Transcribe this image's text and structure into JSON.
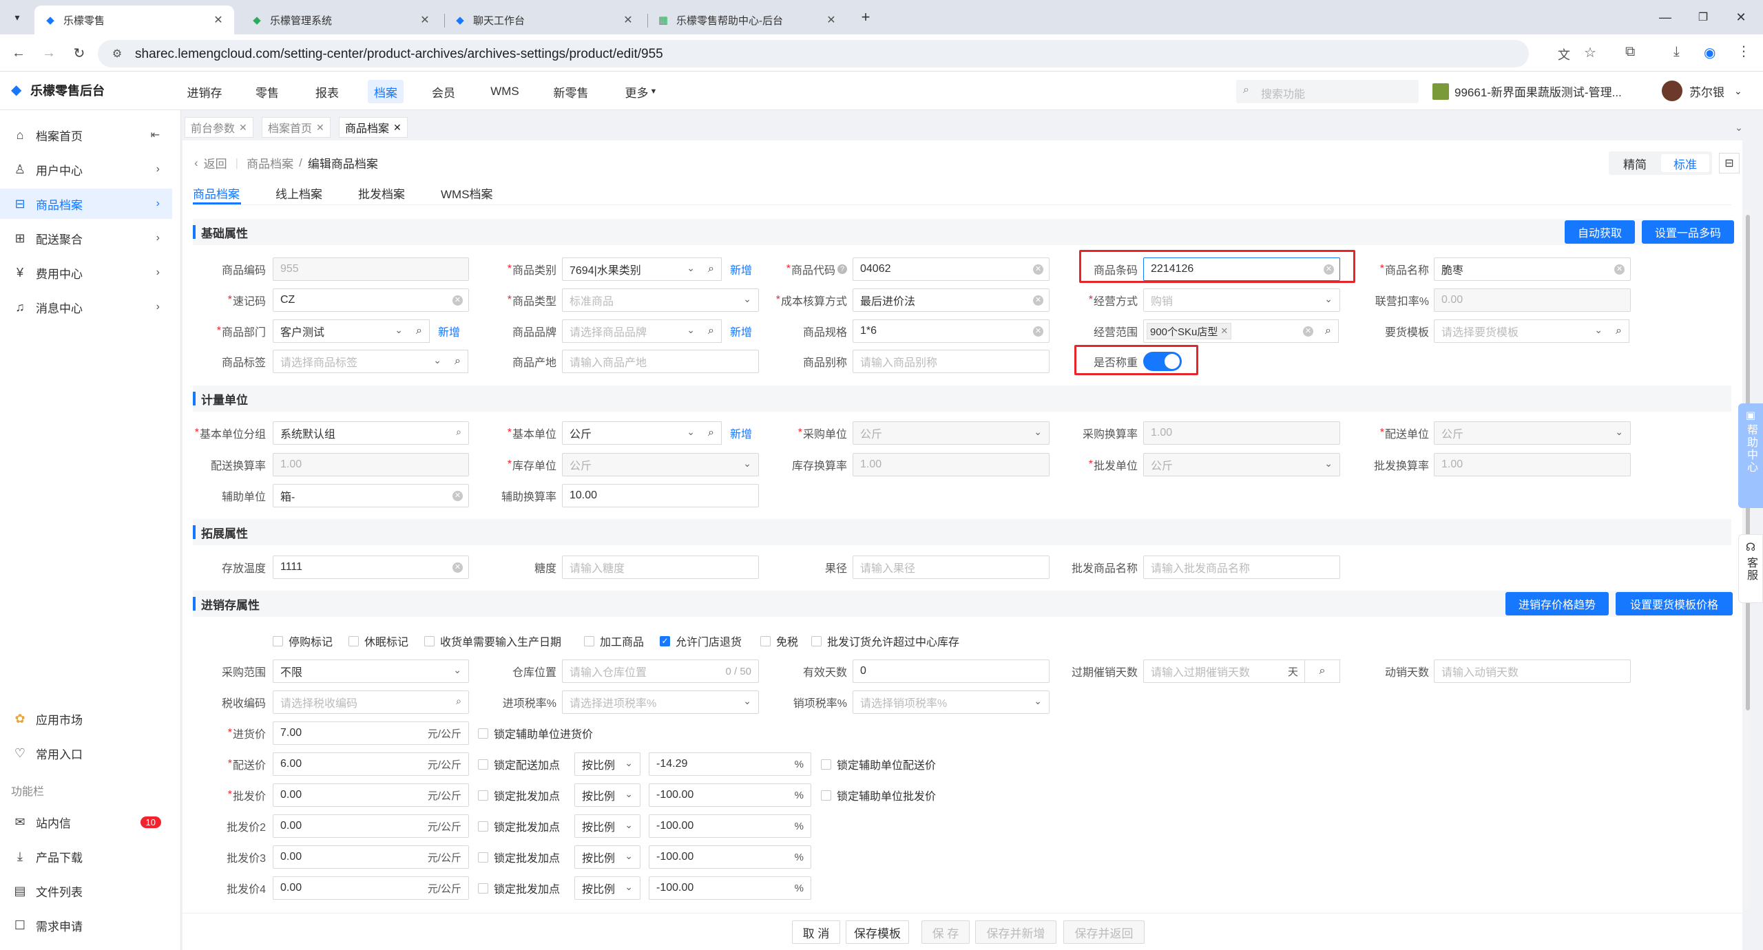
{
  "browser": {
    "tabs": [
      {
        "title": "乐檬零售"
      },
      {
        "title": "乐檬管理系统"
      },
      {
        "title": "聊天工作台"
      },
      {
        "title": "乐檬零售帮助中心-后台"
      }
    ],
    "url": "sharec.lemengcloud.com/setting-center/product-archives/archives-settings/product/edit/955"
  },
  "app": {
    "logo": "乐檬零售后台",
    "nav": [
      "进销存",
      "零售",
      "报表",
      "档案",
      "会员",
      "WMS",
      "新零售",
      "更多"
    ],
    "search_placeholder": "搜索功能",
    "store": "99661-新界面果蔬版测试-管理...",
    "user": "苏尔银"
  },
  "sidebar": {
    "items": [
      {
        "label": "档案首页",
        "icon": "home-icon"
      },
      {
        "label": "用户中心",
        "icon": "user-icon"
      },
      {
        "label": "商品档案",
        "icon": "archive-icon"
      },
      {
        "label": "配送聚合",
        "icon": "delivery-icon"
      },
      {
        "label": "费用中心",
        "icon": "yen-icon"
      },
      {
        "label": "消息中心",
        "icon": "bell-icon"
      }
    ],
    "bottom": [
      {
        "label": "应用市场"
      },
      {
        "label": "常用入口"
      }
    ],
    "section_label": "功能栏",
    "func": [
      {
        "label": "站内信",
        "badge": "10"
      },
      {
        "label": "产品下载"
      },
      {
        "label": "文件列表"
      },
      {
        "label": "需求申请"
      }
    ]
  },
  "page_tabs": [
    "前台参数",
    "档案首页",
    "商品档案"
  ],
  "breadcrumb": {
    "back": "返回",
    "parent": "商品档案",
    "current": "编辑商品档案"
  },
  "mode": {
    "simple": "精简",
    "standard": "标准"
  },
  "sub_tabs": [
    "商品档案",
    "线上档案",
    "批发档案",
    "WMS档案"
  ],
  "basic": {
    "title": "基础属性",
    "btn_auto": "自动获取",
    "btn_multi": "设置一品多码",
    "code_label": "商品编码",
    "code_value": "955",
    "category_label": "商品类别",
    "category_value": "7694|水果类别",
    "add": "新增",
    "pcode_label": "商品代码",
    "pcode_value": "04062",
    "barcode_label": "商品条码",
    "barcode_value": "2214126",
    "name_label": "商品名称",
    "name_value": "脆枣",
    "mnemonic_label": "速记码",
    "mnemonic_value": "CZ",
    "type_label": "商品类型",
    "type_value": "标准商品",
    "cost_label": "成本核算方式",
    "cost_value": "最后进价法",
    "biz_label": "经营方式",
    "biz_value": "购销",
    "rate_label": "联营扣率%",
    "rate_value": "0.00",
    "dept_label": "商品部门",
    "dept_value": "客户测试",
    "brand_label": "商品品牌",
    "brand_placeholder": "请选择商品品牌",
    "spec_label": "商品规格",
    "spec_value": "1*6",
    "scope_label": "经营范围",
    "scope_tag": "900个SKu店型",
    "tpl_label": "要货模板",
    "tpl_placeholder": "请选择要货模板",
    "tag_label": "商品标签",
    "tag_placeholder": "请选择商品标签",
    "origin_label": "商品产地",
    "origin_placeholder": "请输入商品产地",
    "alias_label": "商品别称",
    "alias_placeholder": "请输入商品别称",
    "weigh_label": "是否称重"
  },
  "units": {
    "title": "计量单位",
    "group_label": "基本单位分组",
    "group_value": "系统默认组",
    "base_label": "基本单位",
    "base_value": "公斤",
    "purchase_label": "采购单位",
    "purchase_value": "公斤",
    "pconv_label": "采购换算率",
    "pconv_value": "1.00",
    "dist_label": "配送单位",
    "dist_value": "公斤",
    "dconv_label": "配送换算率",
    "dconv_value": "1.00",
    "stock_label": "库存单位",
    "stock_value": "公斤",
    "sconv_label": "库存换算率",
    "sconv_value": "1.00",
    "whole_label": "批发单位",
    "whole_value": "公斤",
    "wconv_label": "批发换算率",
    "wconv_value": "1.00",
    "aux_label": "辅助单位",
    "aux_value": "箱-",
    "aconv_label": "辅助换算率",
    "aconv_value": "10.00"
  },
  "ext": {
    "title": "拓展属性",
    "temp_label": "存放温度",
    "temp_value": "1111",
    "sugar_label": "糖度",
    "sugar_placeholder": "请输入糖度",
    "dia_label": "果径",
    "dia_placeholder": "请输入果径",
    "wname_label": "批发商品名称",
    "wname_placeholder": "请输入批发商品名称"
  },
  "inv": {
    "title": "进销存属性",
    "btn_trend": "进销存价格趋势",
    "btn_tplprice": "设置要货模板价格",
    "checks": [
      {
        "label": "停购标记",
        "on": false
      },
      {
        "label": "休眠标记",
        "on": false
      },
      {
        "label": "收货单需要输入生产日期",
        "on": false
      },
      {
        "label": "加工商品",
        "on": false
      },
      {
        "label": "允许门店退货",
        "on": true
      },
      {
        "label": "免税",
        "on": false
      },
      {
        "label": "批发订货允许超过中心库存",
        "on": false
      }
    ],
    "prange_label": "采购范围",
    "prange_value": "不限",
    "wh_label": "仓库位置",
    "wh_placeholder": "请输入仓库位置",
    "wh_count": "0 / 50",
    "valid_label": "有效天数",
    "valid_value": "0",
    "expire_label": "过期催销天数",
    "expire_placeholder": "请输入过期催销天数",
    "day": "天",
    "move_label": "动销天数",
    "move_placeholder": "请输入动销天数",
    "tax_label": "税收编码",
    "tax_placeholder": "请选择税收编码",
    "intax_label": "进项税率%",
    "intax_placeholder": "请选择进项税率%",
    "outtax_label": "销项税率%",
    "outtax_placeholder": "请选择销项税率%",
    "unit_suffix": "元/公斤",
    "pct": "%",
    "by_ratio": "按比例",
    "in_price_label": "进货价",
    "in_price_value": "7.00",
    "lock_aux_in": "锁定辅助单位进货价",
    "dist_price_label": "配送价",
    "dist_price_value": "6.00",
    "lock_dist_add": "锁定配送加点",
    "dist_pct": "-14.29",
    "lock_aux_dist": "锁定辅助单位配送价",
    "whole_price_label": "批发价",
    "whole_price_value": "0.00",
    "lock_whole_add": "锁定批发加点",
    "whole_pct": "-100.00",
    "lock_aux_whole": "锁定辅助单位批发价",
    "wp2_label": "批发价2",
    "wp2_value": "0.00",
    "wp2_pct": "-100.00",
    "wp3_label": "批发价3",
    "wp3_value": "0.00",
    "wp3_pct": "-100.00",
    "wp4_label": "批发价4",
    "wp4_value": "0.00",
    "wp4_pct": "-100.00"
  },
  "footer": {
    "cancel": "取 消",
    "save_tpl": "保存模板",
    "save": "保 存",
    "save_new": "保存并新增",
    "save_back": "保存并返回"
  },
  "side_help": {
    "help": "帮助中心",
    "service": "客服"
  }
}
